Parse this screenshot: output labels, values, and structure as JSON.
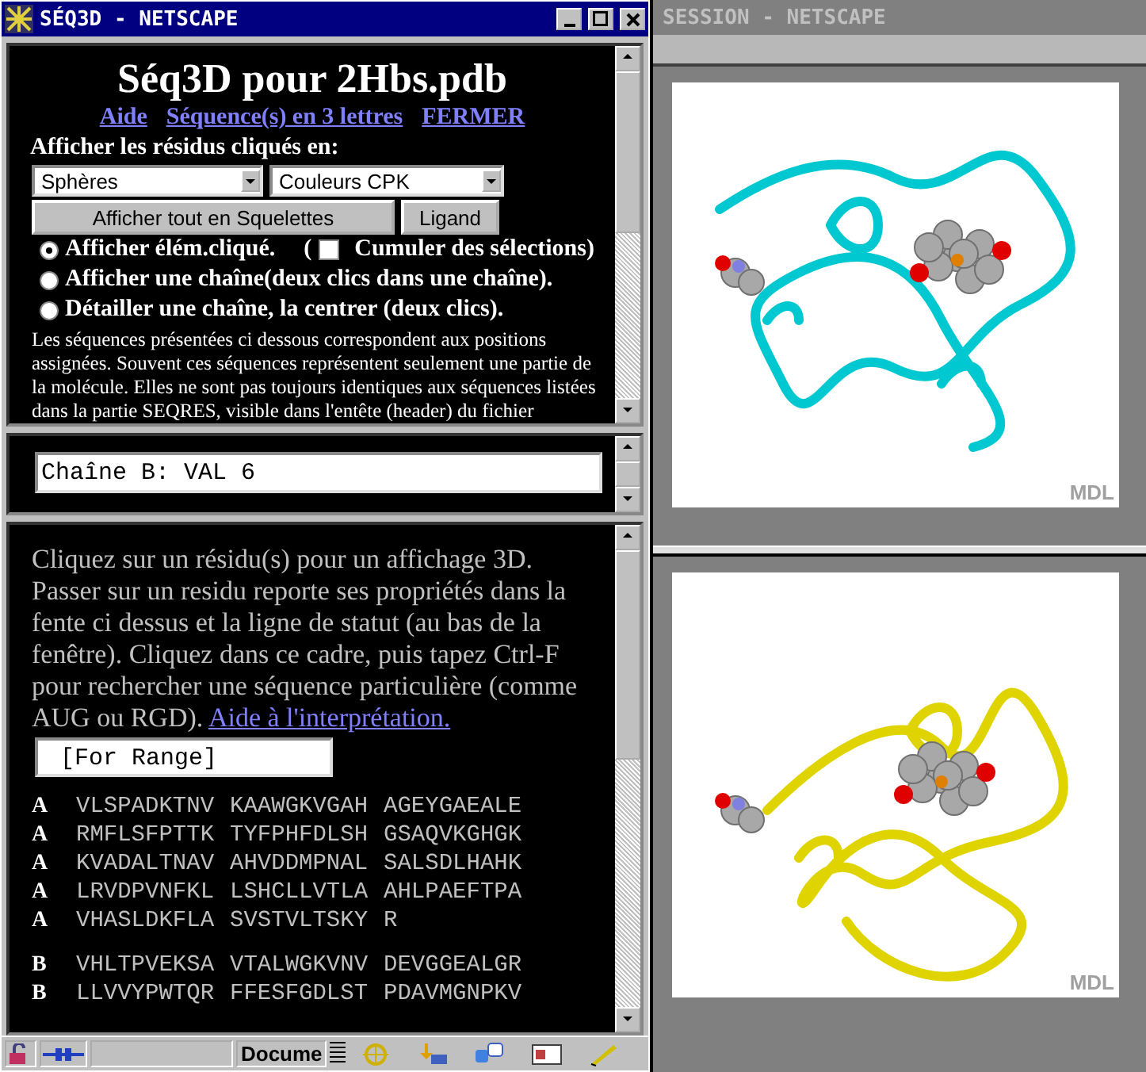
{
  "seq_window": {
    "title": "SÉQ3D - NETSCAPE"
  },
  "heading": "Séq3D pour 2Hbs.pdb",
  "links": [
    "Aide",
    "Séquence(s) en 3 lettres",
    "FERMER"
  ],
  "display_label": "Afficher les résidus cliqués en:",
  "dropdowns": [
    {
      "value": "Sphères"
    },
    {
      "value": "Couleurs CPK"
    }
  ],
  "buttons": [
    "Afficher tout en Squelettes",
    "Ligand"
  ],
  "options": [
    {
      "label": "Afficher élém.cliqué.",
      "selected": true
    },
    {
      "label": "Afficher une chaîne(deux clics dans une chaîne).",
      "selected": false
    },
    {
      "label": "Détailler une chaîne, la centrer (deux clics).",
      "selected": false
    }
  ],
  "checkbox": {
    "open": "(",
    "label": "Cumuler des sélections)",
    "checked": false
  },
  "note": "Les séquences présentées ci dessous correspondent aux positions assignées. Souvent ces séquences représentent seulement une partie de la molécule. Elles ne sont pas toujours identiques aux séquences listées dans la partie SEQRES, visible dans l'entête (header) du fichier",
  "status_field": {
    "value": "Chaîne B: VAL 6"
  },
  "instructions": {
    "text": "Cliquez sur un résidu(s) pour un affichage 3D. Passer sur un residu reporte ses propriétés dans la fente ci dessus et la ligne de statut (au bas de la fenêtre). Cliquez dans ce cadre, puis tapez Ctrl-F pour rechercher une séquence particulière (comme AUG ou RGD).",
    "link": "Aide à l'interprétation."
  },
  "range_field": {
    "value": "[For Range]"
  },
  "chains": [
    {
      "rows": [
        {
          "label": "A",
          "segments": [
            "VLSPADKTNV",
            "KAAWGKVGAH",
            "AGEYGAEALE"
          ]
        },
        {
          "label": "A",
          "segments": [
            "RMFLSFPTTK",
            "TYFPHFDLSH",
            "GSAQVKGHGK"
          ]
        },
        {
          "label": "A",
          "segments": [
            "KVADALTNAV",
            "AHVDDMPNAL",
            "SALSDLHAHK"
          ]
        },
        {
          "label": "A",
          "segments": [
            "LRVDPVNFKL",
            "LSHCLLVTLA",
            "AHLPAEFTPA"
          ]
        },
        {
          "label": "A",
          "segments": [
            "VHASLDKFLA",
            "SVSTVLTSKY",
            "R"
          ]
        }
      ]
    },
    {
      "rows": [
        {
          "label": "B",
          "segments": [
            "VHLTPVEKSA",
            "VTALWGKVNV",
            "DEVGGEALGR"
          ]
        },
        {
          "label": "B",
          "segments": [
            "LLVVYPWTQR",
            "FFESFGDLST",
            "PDAVMGNPKV"
          ]
        }
      ]
    }
  ],
  "status_bar": {
    "text": "Docume"
  },
  "session_window": {
    "title": "SESSION - NETSCAPE"
  },
  "viewers": [
    {
      "color": "#00c8d0",
      "logo": "MDL"
    },
    {
      "color": "#e0d400",
      "logo": "MDL"
    }
  ]
}
